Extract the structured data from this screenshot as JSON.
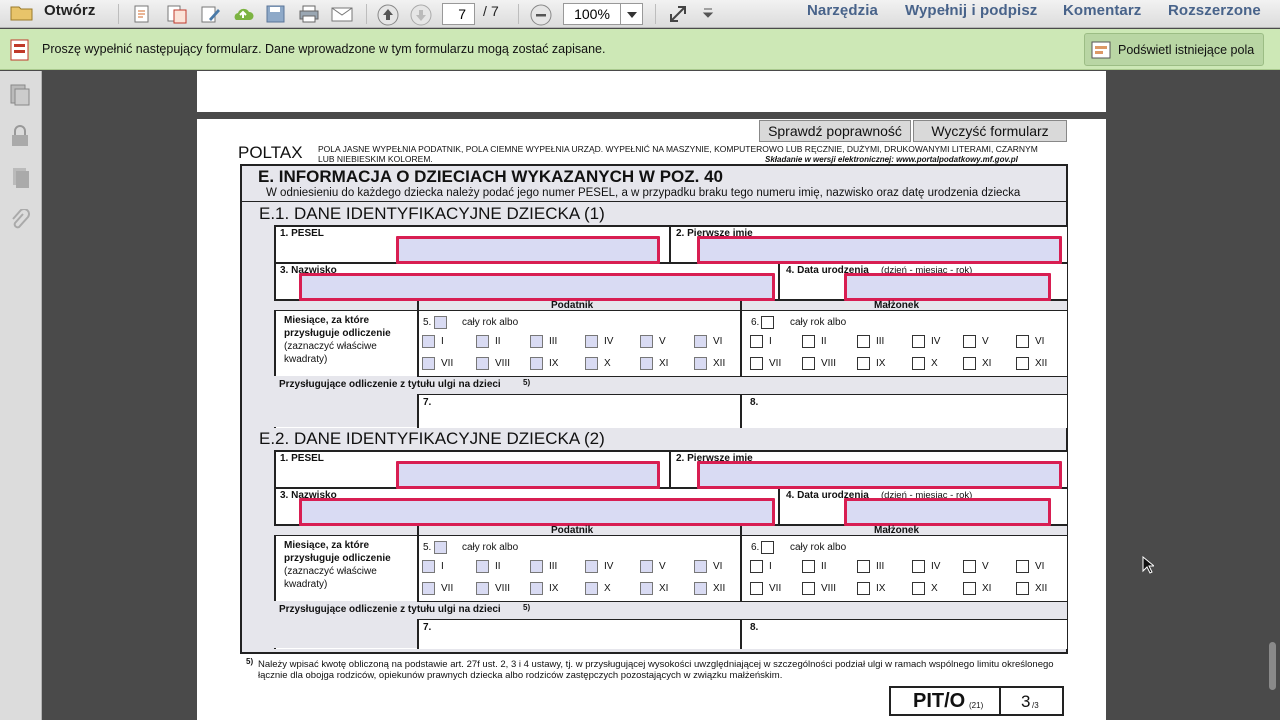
{
  "toolbar": {
    "open_label": "Otwórz",
    "page_current": "7",
    "page_total": "/ 7",
    "zoom": "100%",
    "menus": [
      "Narzędzia",
      "Wypełnij i podpisz",
      "Komentarz",
      "Rozszerzone"
    ]
  },
  "notice": {
    "text": "Proszę wypełnić następujący formularz. Dane wprowadzone w tym formularzu mogą zostać zapisane.",
    "highlight_button": "Podświetl istniejące pola"
  },
  "form": {
    "check_button": "Sprawdź poprawność",
    "clear_button": "Wyczyść formularz",
    "poltax": "POLTAX",
    "instructions": "POLA JASNE WYPEŁNIA PODATNIK, POLA CIEMNE WYPEŁNIA URZĄD. WYPEŁNIĆ NA MASZYNIE, KOMPUTEROWO LUB RĘCZNIE, DUŻYMI, DRUKOWANYMI LITERAMI, CZARNYM LUB NIEBIESKIM KOLOREM.",
    "electronic": "Składanie w wersji elektronicznej: www.portalpodatkowy.mf.gov.pl",
    "section_title": "E. INFORMACJA O DZIECIACH WYKAZANYCH W POZ. 40",
    "section_sub": "W odniesieniu do każdego dziecka należy podać jego numer PESEL, a w przypadku braku tego numeru imię, nazwisko oraz datę urodzenia dziecka",
    "children": [
      {
        "title": "E.1. DANE IDENTYFIKACYJNE DZIECKA (1)",
        "n_pesel": "5.",
        "n_spouse": "6.",
        "n_tax": "7.",
        "n_tax_spouse": "8."
      },
      {
        "title": "E.2. DANE IDENTYFIKACYJNE DZIECKA (2)",
        "n_pesel": "5.",
        "n_spouse": "6.",
        "n_tax": "7.",
        "n_tax_spouse": "8."
      }
    ],
    "labels": {
      "pesel": "1. PESEL",
      "first_name": "2. Pierwsze imię",
      "surname": "3. Nazwisko",
      "birth_date": "4. Data urodzenia",
      "birth_format": "(dzień - miesiąc - rok)",
      "taxpayer": "Podatnik",
      "spouse": "Małżonek",
      "months_1": "Miesiące, za które",
      "months_2": "przysługuje odliczenie",
      "months_3": "(zaznaczyć właściwe",
      "months_4": "kwadraty)",
      "whole_year": "cały rok albo",
      "deduction": "Przysługujące odliczenie z tytułu ulgi na dzieci",
      "deduction_sup": "5)"
    },
    "months_row1": [
      "I",
      "II",
      "III",
      "IV",
      "V",
      "VI"
    ],
    "months_row2": [
      "VII",
      "VIII",
      "IX",
      "X",
      "XI",
      "XII"
    ],
    "footnote_mark": "5)",
    "footnote": "Należy wpisać kwotę obliczoną na podstawie art. 27f ust. 2, 3 i 4 ustawy, tj. w przysługującej wysokości uwzględniającej w szczególności podział ulgi w ramach wspólnego limitu określonego łącznie dla obojga rodziców, opiekunów prawnych dziecka albo rodziców zastępczych pozostających w związku małżeńskim.",
    "form_code": "PIT/O",
    "form_version": "(21)",
    "page_no": "3",
    "page_of": "/3"
  }
}
